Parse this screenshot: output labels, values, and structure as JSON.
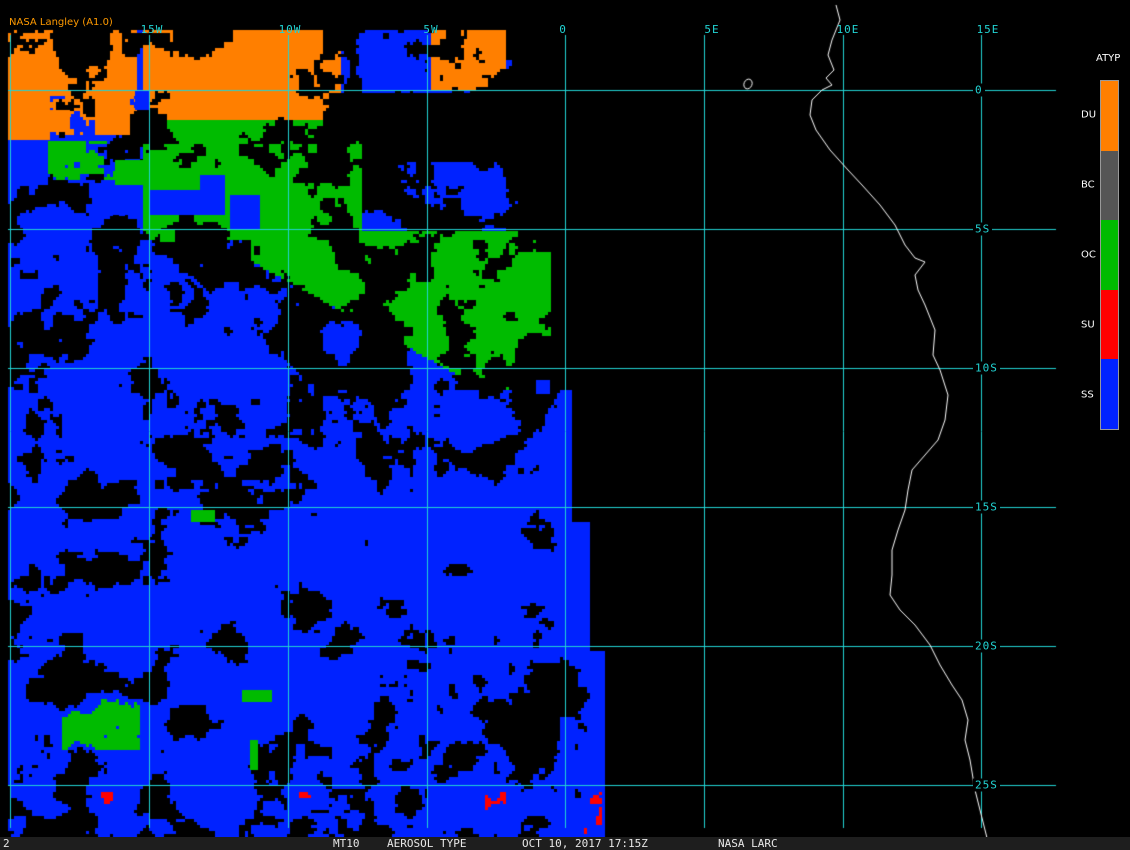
{
  "credit": "NASA Langley (A1.0)",
  "lon_labels": [
    "15W",
    "10W",
    "5W",
    "0",
    "5E",
    "10E",
    "15E"
  ],
  "lat_labels": [
    "0",
    "5S",
    "10S",
    "15S",
    "20S",
    "25S"
  ],
  "legend": {
    "title": "ATYP",
    "classes": [
      {
        "label": "DU",
        "color": "#ff7f00"
      },
      {
        "label": "BC",
        "color": "#555555"
      },
      {
        "label": "OC",
        "color": "#00bb00"
      },
      {
        "label": "SU",
        "color": "#ff0000"
      },
      {
        "label": "SS",
        "color": "#0022ff"
      }
    ]
  },
  "footer": {
    "corner": "2",
    "product": "MT10",
    "parameter": "AEROSOL TYPE",
    "datetime": "OCT 10, 2017 17:15Z",
    "source": "NASA LARC"
  },
  "colors": {
    "background": "#000000",
    "grid": "#22d4d4",
    "coastline": "#ffffff",
    "credit_text": "#ff9a00"
  }
}
